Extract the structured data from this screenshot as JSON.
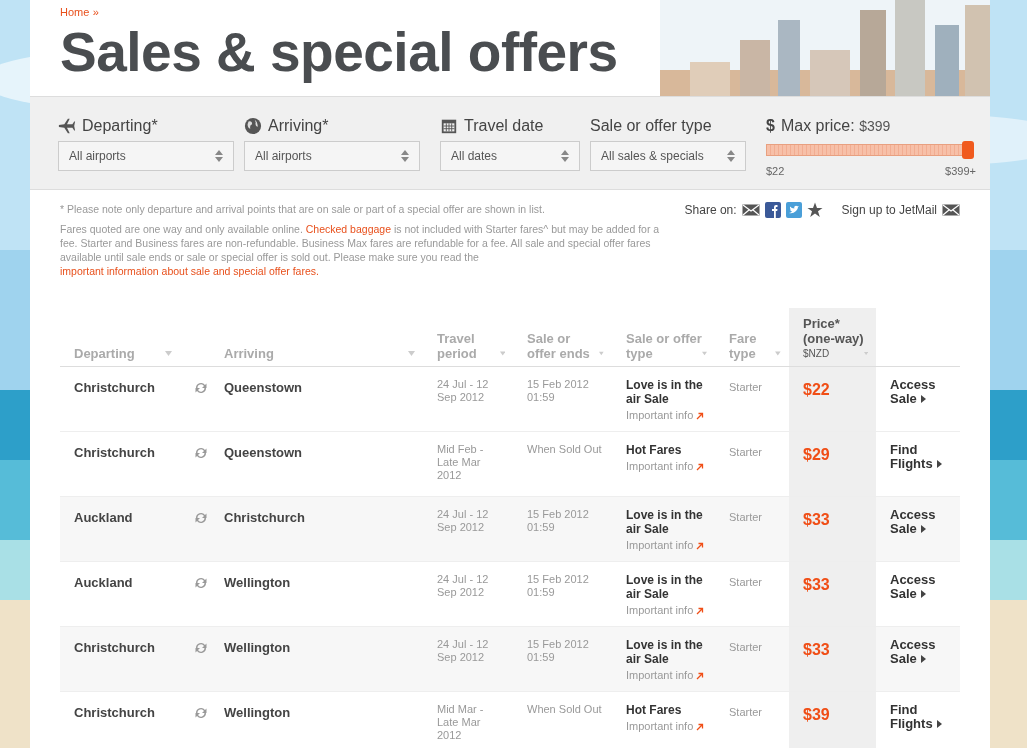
{
  "breadcrumb": {
    "link": "Home",
    "separator": "»"
  },
  "title": "Sales & special offers",
  "filters": [
    {
      "kind": "plane",
      "label": "Departing*",
      "value": "All airports"
    },
    {
      "kind": "globe",
      "label": "Arriving*",
      "value": "All airports"
    },
    {
      "kind": "calendar",
      "label": "Travel date",
      "value": "All dates"
    },
    {
      "kind": "none",
      "label": "Sale or offer type",
      "value": "All sales & specials"
    }
  ],
  "price_filter": {
    "symbol": "$",
    "label": "Max price:",
    "value": "$399",
    "level": 1,
    "min_label": "$22",
    "max_label": "$399+"
  },
  "note": "* Please note only departure and arrival points that are on sale or part of a special offer are shown in list.",
  "disclaimer": {
    "text_before": "Fares quoted are one way and only available online.",
    "link_1": "Checked baggage",
    "text_middle": "is not included with Starter fares^ but may be added for a fee. Starter and Business fares are non-refundable. Business Max fares are refundable for a fee. All sale and special offer fares available until sale ends or sale or special offer is sold out. Please make sure you read the",
    "link_2": "important information about sale and special offer fares."
  },
  "share": {
    "label": "Share on:",
    "signup": "Sign up to JetMail"
  },
  "table": {
    "columns": [
      {
        "label": "Departing"
      },
      {
        "label": "Arriving"
      },
      {
        "label": "Travel period"
      },
      {
        "label": "Sale or offer ends"
      },
      {
        "label": "Sale or offer type"
      },
      {
        "label": "Fare type"
      },
      {
        "label": "Price* (one-way)",
        "sublabel": "$NZD"
      }
    ],
    "rows": [
      {
        "departing": "Christchurch",
        "arriving": "Queenstown",
        "travel_period": "24 Jul - 12 Sep 2012",
        "sale_ends": "15 Feb 2012 01:59",
        "offer_type": "Love is in the air Sale",
        "info": "Important info",
        "fare_type": "Starter",
        "price": "$22",
        "action": "Access Sale"
      },
      {
        "departing": "Christchurch",
        "arriving": "Queenstown",
        "travel_period": "Mid Feb - Late Mar 2012",
        "sale_ends": "When Sold Out",
        "offer_type": "Hot Fares",
        "info": "Important info",
        "fare_type": "Starter",
        "price": "$29",
        "action": "Find Flights"
      },
      {
        "departing": "Auckland",
        "arriving": "Christchurch",
        "travel_period": "24 Jul - 12 Sep 2012",
        "sale_ends": "15 Feb 2012 01:59",
        "offer_type": "Love is in the air Sale",
        "info": "Important info",
        "fare_type": "Starter",
        "price": "$33",
        "action": "Access Sale"
      },
      {
        "departing": "Auckland",
        "arriving": "Wellington",
        "travel_period": "24 Jul - 12 Sep 2012",
        "sale_ends": "15 Feb 2012 01:59",
        "offer_type": "Love is in the air Sale",
        "info": "Important info",
        "fare_type": "Starter",
        "price": "$33",
        "action": "Access Sale"
      },
      {
        "departing": "Christchurch",
        "arriving": "Wellington",
        "travel_period": "24 Jul - 12 Sep 2012",
        "sale_ends": "15 Feb 2012 01:59",
        "offer_type": "Love is in the air Sale",
        "info": "Important info",
        "fare_type": "Starter",
        "price": "$33",
        "action": "Access Sale"
      },
      {
        "departing": "Christchurch",
        "arriving": "Wellington",
        "travel_period": "Mid Mar - Late Mar 2012",
        "sale_ends": "When Sold Out",
        "offer_type": "Hot Fares",
        "info": "Important info",
        "fare_type": "Starter",
        "price": "$39",
        "action": "Find Flights"
      }
    ]
  }
}
